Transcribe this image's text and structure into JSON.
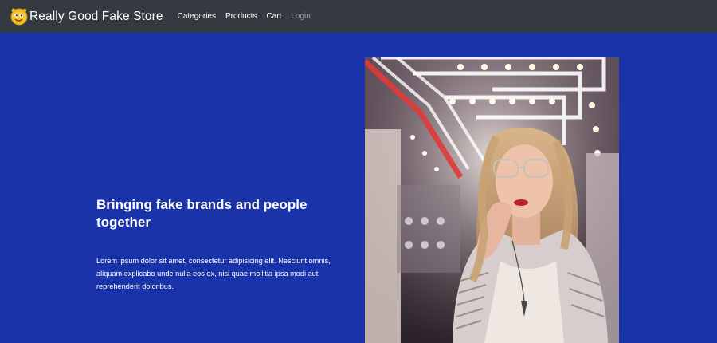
{
  "navbar": {
    "brand_text": "Really Good Fake Store",
    "logo_icon": "smiley-face-icon",
    "links": [
      {
        "label": "Categories"
      },
      {
        "label": "Products"
      },
      {
        "label": "Cart"
      },
      {
        "label": "Login"
      }
    ]
  },
  "hero": {
    "title": "Bringing fake brands and people together",
    "text": "Lorem ipsum dolor sit amet, consectetur adipisicing elit. Nesciunt omnis, aliquam explicabo unde nulla eos ex, nisi quae mollitia ipsa modi aut reprehenderit doloribus.",
    "image_icon": "woman-portrait-photo"
  },
  "colors": {
    "background": "#1a33a8",
    "navbar": "#343a40",
    "muted_link": "#9a9da1"
  }
}
